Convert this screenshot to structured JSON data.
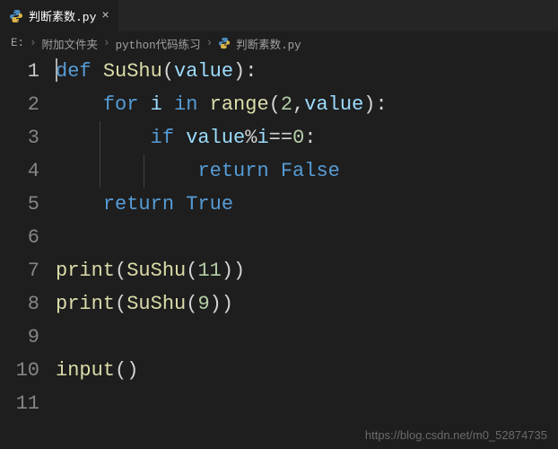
{
  "tab": {
    "filename": "判断素数.py",
    "close_glyph": "×"
  },
  "breadcrumb": {
    "parts": [
      "E:",
      "附加文件夹",
      "python代码练习",
      "判断素数.py"
    ]
  },
  "code": {
    "line_count": 11,
    "active_line": 1,
    "lines": [
      {
        "n": 1,
        "indent": 0,
        "tokens": [
          [
            "kw",
            "def"
          ],
          [
            "punc",
            " "
          ],
          [
            "fn",
            "SuShu"
          ],
          [
            "punc",
            "("
          ],
          [
            "var",
            "value"
          ],
          [
            "punc",
            ")"
          ],
          [
            "punc",
            ":"
          ]
        ]
      },
      {
        "n": 2,
        "indent": 1,
        "tokens": [
          [
            "kw",
            "for"
          ],
          [
            "punc",
            " "
          ],
          [
            "var",
            "i"
          ],
          [
            "punc",
            " "
          ],
          [
            "kw",
            "in"
          ],
          [
            "punc",
            " "
          ],
          [
            "fn",
            "range"
          ],
          [
            "punc",
            "("
          ],
          [
            "num",
            "2"
          ],
          [
            "punc",
            ","
          ],
          [
            "var",
            "value"
          ],
          [
            "punc",
            ")"
          ],
          [
            "punc",
            ":"
          ]
        ]
      },
      {
        "n": 3,
        "indent": 2,
        "tokens": [
          [
            "kw",
            "if"
          ],
          [
            "punc",
            " "
          ],
          [
            "var",
            "value"
          ],
          [
            "op",
            "%"
          ],
          [
            "var",
            "i"
          ],
          [
            "op",
            "=="
          ],
          [
            "num",
            "0"
          ],
          [
            "punc",
            ":"
          ]
        ]
      },
      {
        "n": 4,
        "indent": 3,
        "tokens": [
          [
            "kw",
            "return"
          ],
          [
            "punc",
            " "
          ],
          [
            "bool",
            "False"
          ]
        ]
      },
      {
        "n": 5,
        "indent": 1,
        "tokens": [
          [
            "kw",
            "return"
          ],
          [
            "punc",
            " "
          ],
          [
            "bool",
            "True"
          ]
        ]
      },
      {
        "n": 6,
        "indent": 0,
        "tokens": []
      },
      {
        "n": 7,
        "indent": 0,
        "tokens": [
          [
            "fn",
            "print"
          ],
          [
            "punc",
            "("
          ],
          [
            "fn",
            "SuShu"
          ],
          [
            "punc",
            "("
          ],
          [
            "num",
            "11"
          ],
          [
            "punc",
            ")"
          ],
          [
            "punc",
            ")"
          ]
        ]
      },
      {
        "n": 8,
        "indent": 0,
        "tokens": [
          [
            "fn",
            "print"
          ],
          [
            "punc",
            "("
          ],
          [
            "fn",
            "SuShu"
          ],
          [
            "punc",
            "("
          ],
          [
            "num",
            "9"
          ],
          [
            "punc",
            ")"
          ],
          [
            "punc",
            ")"
          ]
        ]
      },
      {
        "n": 9,
        "indent": 0,
        "tokens": []
      },
      {
        "n": 10,
        "indent": 0,
        "tokens": [
          [
            "fn",
            "input"
          ],
          [
            "punc",
            "("
          ],
          [
            "punc",
            ")"
          ]
        ]
      },
      {
        "n": 11,
        "indent": 0,
        "tokens": []
      }
    ]
  },
  "watermark": "https://blog.csdn.net/m0_52874735",
  "icons": {
    "python_color": "#3b78a7"
  }
}
